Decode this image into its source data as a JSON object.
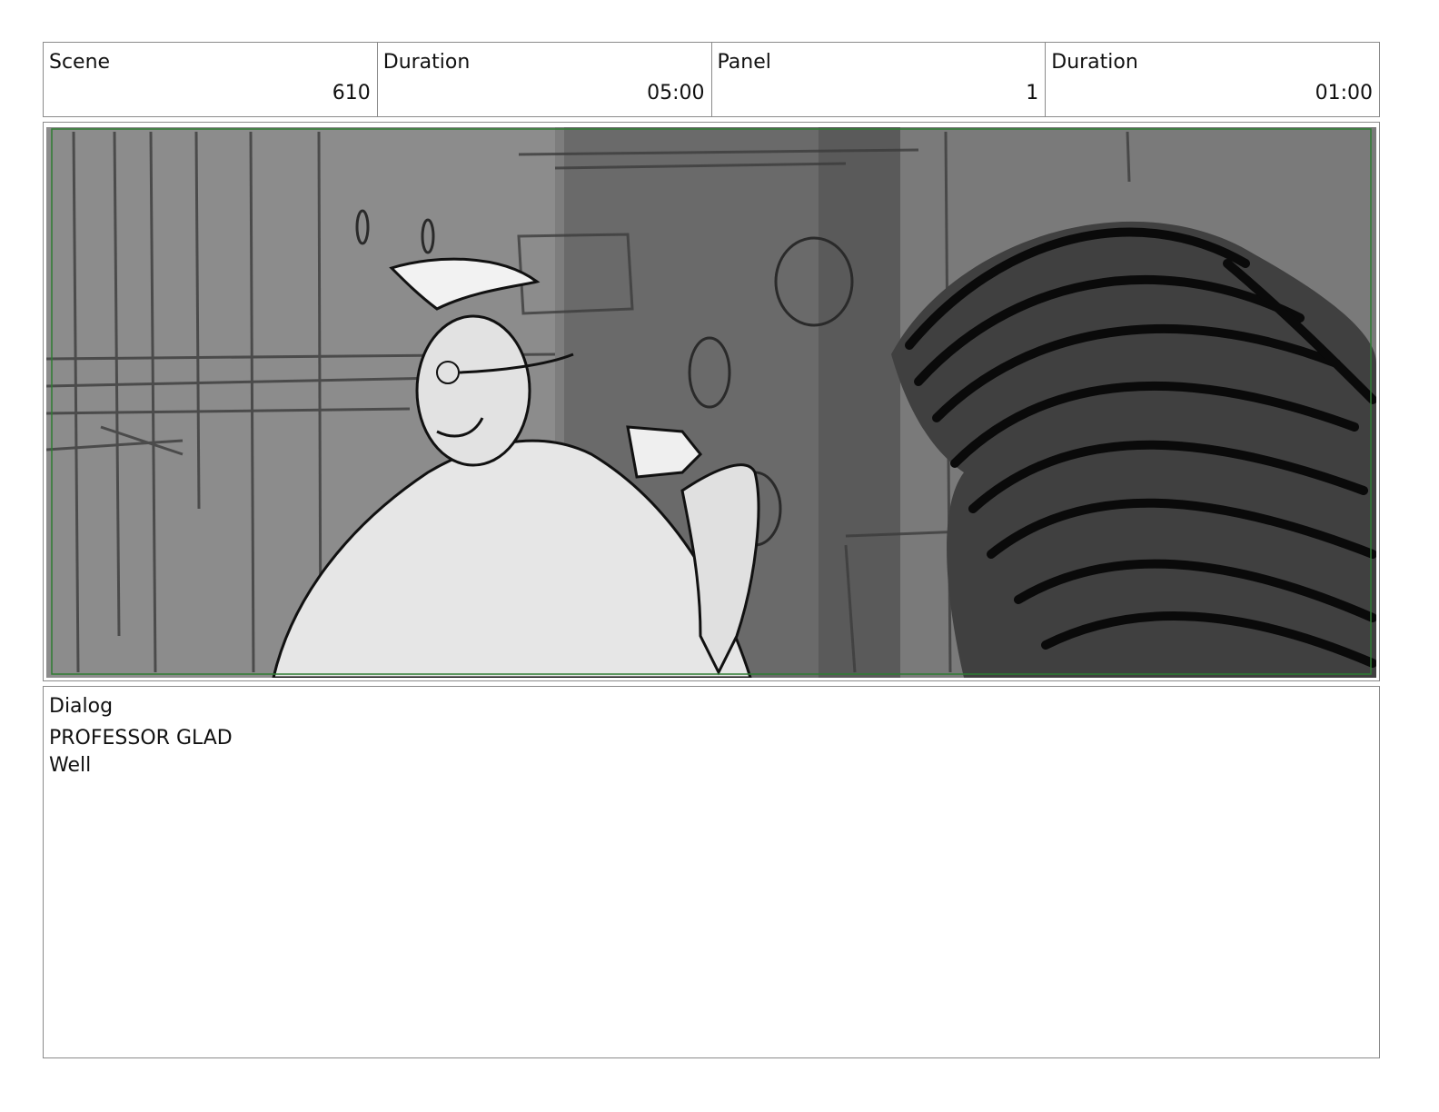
{
  "header": {
    "scene_label": "Scene",
    "scene_value": "610",
    "scene_duration_label": "Duration",
    "scene_duration_value": "05:00",
    "panel_label": "Panel",
    "panel_value": "1",
    "panel_duration_label": "Duration",
    "panel_duration_value": "01:00"
  },
  "image": {
    "icon": "storyboard-sketch",
    "safe_area_color": "#2e7d32"
  },
  "dialog": {
    "label": "Dialog",
    "speaker": "PROFESSOR GLAD",
    "text": "Well"
  }
}
